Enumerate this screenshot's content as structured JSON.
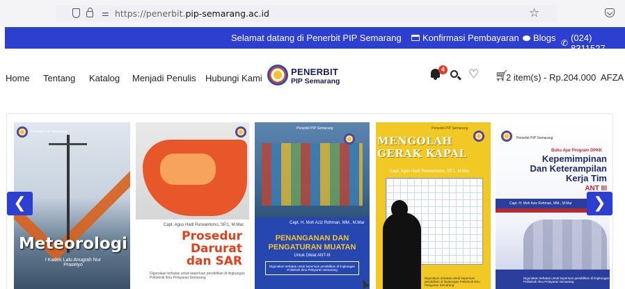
{
  "browser": {
    "url_prefix": "https://penerbit.",
    "url_domain": "pip-semarang.ac.id",
    "icons": [
      "shield-icon",
      "lock-icon",
      "permissions-icon",
      "bookmark-star-icon",
      "pocket-icon"
    ]
  },
  "top_banner": {
    "welcome": "Selamat datang di Penerbit PIP Semarang",
    "links": [
      {
        "label": "Konfirmasi Pembayaran",
        "icon": "credit-card-icon"
      },
      {
        "label": "Blogs",
        "icon": "chat-icon"
      },
      {
        "label": "(024) 8311527",
        "icon": "phone-icon"
      }
    ],
    "color": "#2d3fd0"
  },
  "nav": {
    "items": [
      "Home",
      "Tentang",
      "Katalog",
      "Menjadi Penulis",
      "Hubungi Kami"
    ],
    "logo": {
      "line1": "PENERBIT",
      "line2": "PIP Semarang"
    },
    "notification_count": "4",
    "cart_text": "2 item(s) - Rp.204.000",
    "user": "AFZA"
  },
  "slider": {
    "prev_icon": "chevron-left-icon",
    "next_icon": "chevron-right-icon",
    "prev_glyph": "❮",
    "next_glyph": "❯",
    "books": [
      {
        "publisher": "Penerbit PIP Semarang",
        "title": "Meteorologi",
        "authors": "I Kadek Lalu Anugrah Nur Prasetyo"
      },
      {
        "authors": "Capt. Agus Hadi Purwantomo, SP.1, M.Mar.",
        "title_line1": "Prosedur Darurat",
        "title_line2": "dan SAR",
        "footer": "Digunakan terbatas untuk keperluan pendidikan di lingkungan Politeknik Ilmu Pelayaran Semarang"
      },
      {
        "publisher": "Penerbit PIP Semarang",
        "authors": "Capt. H. Moh Aziz Rohman, MM., M.Mar",
        "title_line1": "PENANGANAN DAN",
        "title_line2": "PENGATURAN MUATAN",
        "subtitle": "Untuk Diklat ANT-III",
        "footer": "Digunakan terbatas untuk keperluan pendidikan di lingkungan Politeknik Ilmu Pelayaran Semarang"
      },
      {
        "publisher": "Penerbit PIP Semarang",
        "title_line1": "MENGOLAH",
        "title_line2": "GERAK KAPAL",
        "authors": "Capt. Agus Hadi Purwantomo, SP.1, M.Mar",
        "footer": "Digunakan terbatas untuk keperluan pendidikan di lingkungan Politeknik Ilmu Pelayaran Semarang"
      },
      {
        "publisher": "Penerbit PIP Semarang",
        "program": "Buku Ajar Program DPKK",
        "title_line1": "Kepemimpinan",
        "title_line2": "Dan Keterampilan",
        "title_line3": "Kerja Tim",
        "level": "ANT III",
        "authors": "Capt. H. Moh Aziz Rohman, MM., M.Mar",
        "footer": "Digunakan terbatas untuk keperluan pendidikan di lingkungan Politeknik Ilmu Pelayaran Semarang"
      }
    ]
  }
}
